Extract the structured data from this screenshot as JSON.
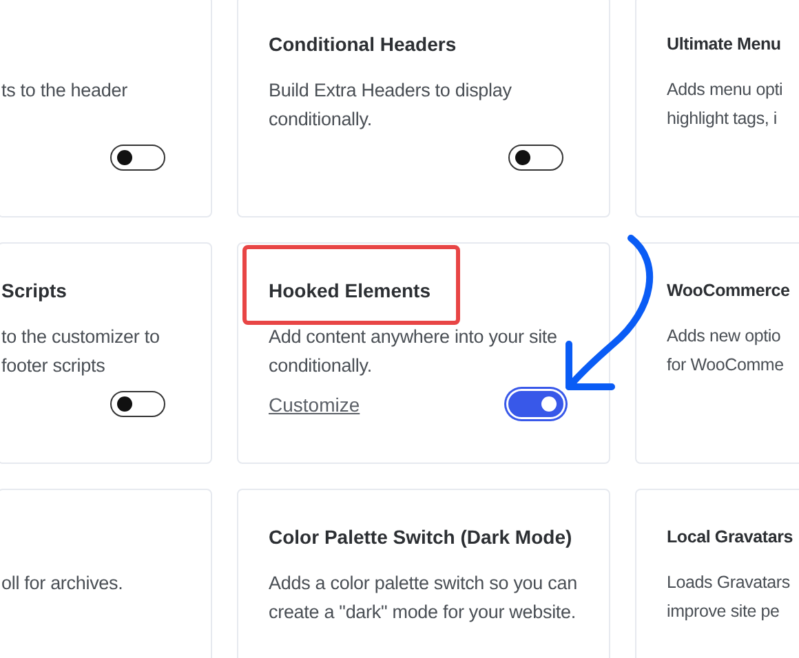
{
  "rows": [
    {
      "cards": [
        {
          "description": "ts to the header",
          "toggle": {
            "on": false
          },
          "highlighted": false
        },
        {
          "title": "Conditional Headers",
          "description": "Build Extra Headers to display conditionally.",
          "toggle": {
            "on": false
          },
          "highlighted": false
        },
        {
          "title": "Ultimate Menu",
          "description": "Adds menu opti\nhighlight tags, i",
          "highlighted": false
        }
      ]
    },
    {
      "cards": [
        {
          "title": "Scripts",
          "description": "to the customizer to\nfooter scripts",
          "toggle": {
            "on": false
          },
          "highlighted": false
        },
        {
          "title": "Hooked Elements",
          "description": "Add content anywhere into your site conditionally.",
          "link": "Customize",
          "toggle": {
            "on": true
          },
          "highlighted": true
        },
        {
          "title": "WooCommerce",
          "description": "Adds new optio\nfor WooComme",
          "highlighted": false
        }
      ]
    },
    {
      "cards": [
        {
          "description": "oll for archives.",
          "highlighted": false
        },
        {
          "title": "Color Palette Switch (Dark Mode)",
          "description": "Adds a color palette switch so you can create a \"dark\" mode for your website.",
          "highlighted": false
        },
        {
          "title": "Local Gravatars",
          "description": "Loads Gravatars\nimprove site pe",
          "highlighted": false
        }
      ]
    }
  ]
}
